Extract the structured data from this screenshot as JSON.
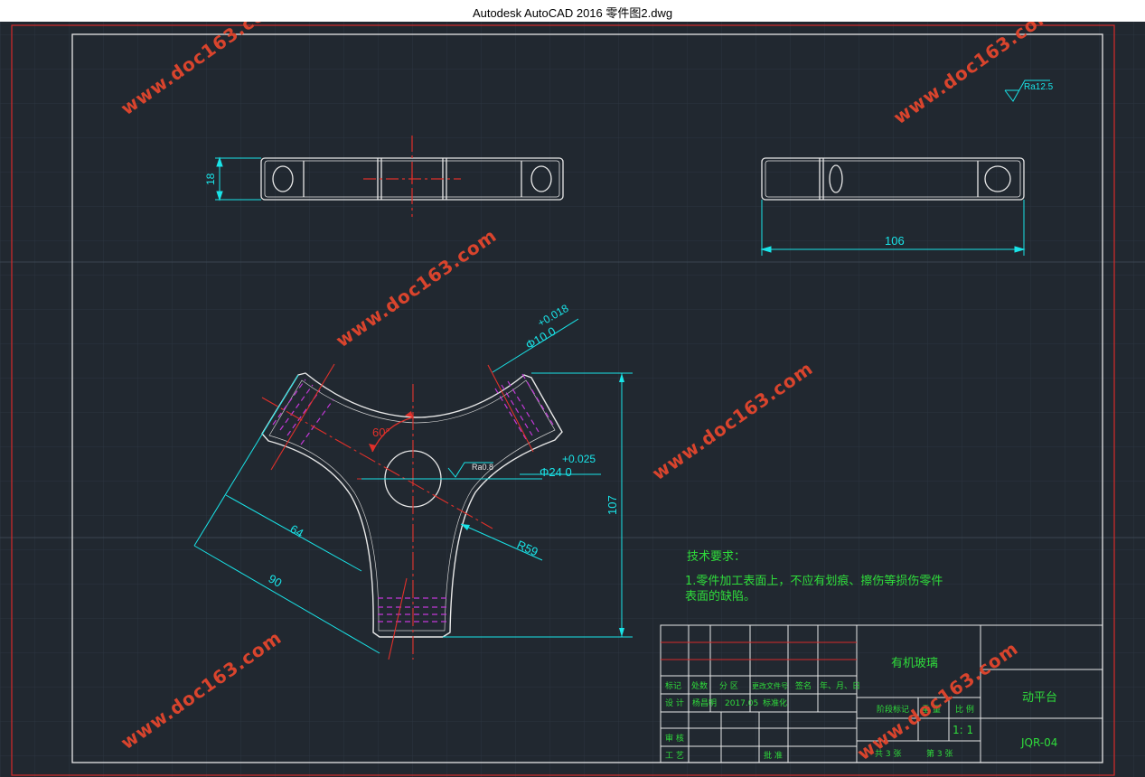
{
  "window": {
    "title": "Autodesk AutoCAD 2016    零件图2.dwg"
  },
  "colors": {
    "background": "#212830",
    "part_outline": "#e8e8e8",
    "dimension": "#19e4e8",
    "centerline": "#e0302a",
    "hidden": "#c238d8",
    "note_text": "#2fdc3b",
    "watermark": "#d9442d"
  },
  "watermark": "www.doc163.com",
  "dimensions": {
    "thickness": "18",
    "length": "106",
    "hole_small": "Φ10 0",
    "hole_small_tol": "+0.018",
    "hole_center": "Φ24 0",
    "hole_center_tol": "+0.025",
    "angle": "60°",
    "dist_64": "64",
    "dist_90": "90",
    "radius": "R59",
    "height": "107",
    "surface_general": "Ra12.5",
    "surface_bore": "Ra0.8"
  },
  "tech_notes": {
    "title": "技术要求：",
    "line1": "1.零件加工表面上，不应有划痕、擦伤等损伤零件",
    "line2": "表面的缺陷。"
  },
  "title_block": {
    "material": "有机玻璃",
    "part_name": "动平台",
    "drawing_no": "JQR-04",
    "scale": "1: 1",
    "header": [
      "标记",
      "处数",
      "分 区",
      "更改文件号",
      "签名",
      "年、月、日"
    ],
    "designer_label": "设 计",
    "designer": "杨昌明",
    "date": "2017.05",
    "std_label": "标准化",
    "review_label": "审 核",
    "process_label": "工 艺",
    "approve_label": "批 准",
    "stage_label": "阶段标记",
    "weight_label": "重 量",
    "scale_label": "比 例",
    "sheet_total": "共 3 张",
    "sheet_no": "第 3 张"
  }
}
